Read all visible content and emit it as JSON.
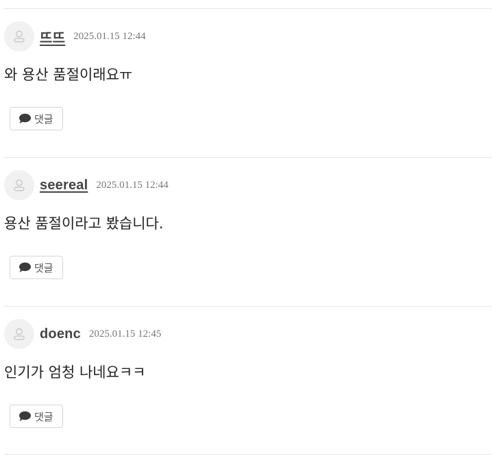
{
  "comments": [
    {
      "author": "뜨뜨",
      "timestamp": "2025.01.15 12:44",
      "text": "와 용산 품절이래요ㅠ",
      "reply_label": "댓글"
    },
    {
      "author": "seereal",
      "timestamp": "2025.01.15 12:44",
      "text": "용산 품절이라고 봤습니다.",
      "reply_label": "댓글"
    },
    {
      "author": "doenc",
      "timestamp": "2025.01.15 12:45",
      "text": "인기가 엄청 나네요ㅋㅋ",
      "reply_label": "댓글"
    }
  ],
  "icons": {
    "avatar": "user-outline-icon",
    "reply": "speech-bubble-icon"
  },
  "colors": {
    "divider": "#e6e6e6",
    "avatar_bg": "#f1f1f1",
    "author": "#444444",
    "timestamp": "#777777",
    "text": "#222222"
  }
}
